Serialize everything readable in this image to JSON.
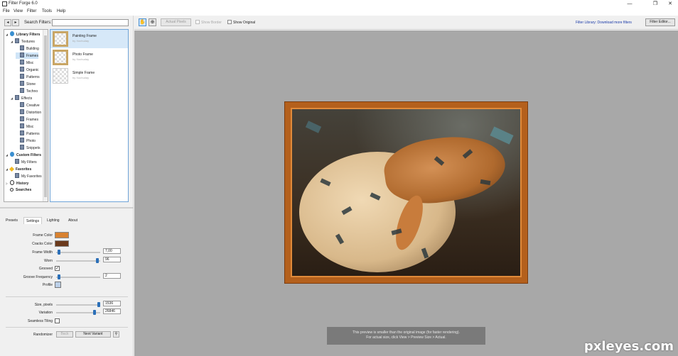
{
  "window": {
    "title": "Filter Forge 6.0",
    "minimize": "—",
    "maximize": "❐",
    "close": "✕"
  },
  "menu": [
    "File",
    "View",
    "Filter",
    "Tools",
    "Help"
  ],
  "search": {
    "label": "Search Filters:",
    "value": ""
  },
  "tree": [
    {
      "label": "Library Filters",
      "level": 0,
      "icon": "globe-icon",
      "bold": true,
      "expanded": true
    },
    {
      "label": "Textures",
      "level": 1,
      "icon": "library-icon",
      "expanded": true
    },
    {
      "label": "Building",
      "level": 2,
      "icon": "library-icon"
    },
    {
      "label": "Frames",
      "level": 2,
      "icon": "library-icon",
      "selected": true
    },
    {
      "label": "Misc",
      "level": 2,
      "icon": "library-icon"
    },
    {
      "label": "Organic",
      "level": 2,
      "icon": "library-icon"
    },
    {
      "label": "Patterns",
      "level": 2,
      "icon": "library-icon"
    },
    {
      "label": "Stone",
      "level": 2,
      "icon": "library-icon"
    },
    {
      "label": "Techno",
      "level": 2,
      "icon": "library-icon"
    },
    {
      "label": "Effects",
      "level": 1,
      "icon": "library-icon",
      "expanded": true
    },
    {
      "label": "Creative",
      "level": 2,
      "icon": "library-icon"
    },
    {
      "label": "Distortion",
      "level": 2,
      "icon": "library-icon"
    },
    {
      "label": "Frames",
      "level": 2,
      "icon": "library-icon"
    },
    {
      "label": "Misc",
      "level": 2,
      "icon": "library-icon"
    },
    {
      "label": "Patterns",
      "level": 2,
      "icon": "library-icon"
    },
    {
      "label": "Photo",
      "level": 2,
      "icon": "library-icon"
    },
    {
      "label": "Snippets",
      "level": 2,
      "icon": "library-icon"
    },
    {
      "label": "Custom Filters",
      "level": 0,
      "icon": "globe-icon",
      "bold": true,
      "expanded": true
    },
    {
      "label": "My Filters",
      "level": 1,
      "icon": "library-icon"
    },
    {
      "label": "Favorites",
      "level": 0,
      "icon": "star-icon",
      "bold": true,
      "expanded": true
    },
    {
      "label": "My Favorites",
      "level": 1,
      "icon": "library-icon"
    },
    {
      "label": "History",
      "level": 0,
      "icon": "clock-icon",
      "bold": true,
      "expanded": false
    },
    {
      "label": "Searches",
      "level": 0,
      "icon": "magnifier-icon",
      "bold": true
    }
  ],
  "filters": [
    {
      "name": "Painting Frame",
      "author": "by Xochuday",
      "selected": true
    },
    {
      "name": "Photo Frame",
      "author": "by Xochuday"
    },
    {
      "name": "Simple Frame",
      "author": "by Xochuday"
    }
  ],
  "tabs": [
    "Presets",
    "Settings",
    "Lighting",
    "About"
  ],
  "settings": {
    "frame_color_label": "Frame Color",
    "frame_color": "#d98230",
    "cracks_color_label": "Cracks Color",
    "cracks_color": "#6b3a1c",
    "frame_width_label": "Frame Width",
    "frame_width": "7,00",
    "worn_label": "Worn",
    "worn": "96",
    "grooved_label": "Grooved",
    "groove_freq_label": "Groove Frequency",
    "groove_freq": "2",
    "profile_label": "Profile",
    "size_label": "Size, pixels",
    "size": "1536",
    "variation_label": "Variation",
    "variation": "26846",
    "seamless_label": "Seamless Tiling",
    "randomizer_label": "Randomizer",
    "back_label": "Back",
    "next_variant_label": "Next Variant"
  },
  "toolbar": {
    "actual_pixels": "Actual Pixels",
    "show_border": "Show Border",
    "show_original": "Show Original",
    "library_link": "Filter Library: Download more filters",
    "filter_editor": "Filter Editor..."
  },
  "preview_notice": {
    "line1": "This preview is smaller than the original image (for faster rendering).",
    "line2": "For actual size, click View > Preview Size > Actual."
  },
  "watermark": "pxleyes.com"
}
